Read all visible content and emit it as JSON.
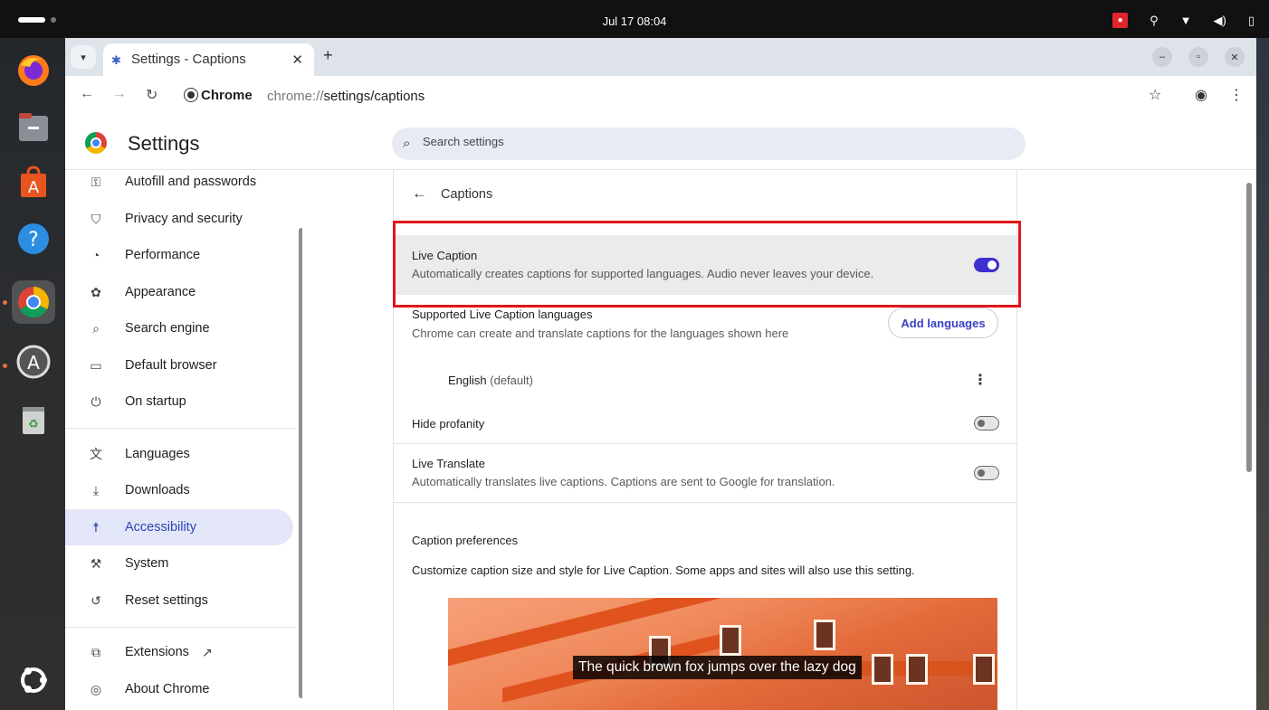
{
  "topbar": {
    "clock": "Jul 17  08:04"
  },
  "browser": {
    "tab_title": "Settings - Captions",
    "url_chip": "Chrome",
    "url_prefix": "chrome://",
    "url_path": "settings/captions"
  },
  "settings": {
    "title": "Settings",
    "search_placeholder": "Search settings"
  },
  "sidebar": {
    "items": [
      {
        "label": "Autofill and passwords",
        "icon": "key-icon"
      },
      {
        "label": "Privacy and security",
        "icon": "shield-icon"
      },
      {
        "label": "Performance",
        "icon": "speedometer-icon"
      },
      {
        "label": "Appearance",
        "icon": "palette-icon"
      },
      {
        "label": "Search engine",
        "icon": "search-icon"
      },
      {
        "label": "Default browser",
        "icon": "browser-window-icon"
      },
      {
        "label": "On startup",
        "icon": "power-icon"
      },
      {
        "label": "Languages",
        "icon": "translate-icon"
      },
      {
        "label": "Downloads",
        "icon": "download-icon"
      },
      {
        "label": "Accessibility",
        "icon": "accessibility-icon",
        "selected": true
      },
      {
        "label": "System",
        "icon": "wrench-icon"
      },
      {
        "label": "Reset settings",
        "icon": "reset-icon"
      },
      {
        "label": "Extensions",
        "icon": "puzzle-icon"
      },
      {
        "label": "About Chrome",
        "icon": "chrome-icon"
      }
    ]
  },
  "captions": {
    "header": "Captions",
    "live_caption_title": "Live Caption",
    "live_caption_desc": "Automatically creates captions for supported languages. Audio never leaves your device.",
    "live_caption_on": true,
    "supported_title": "Supported Live Caption languages",
    "supported_desc": "Chrome can create and translate captions for the languages shown here",
    "add_languages": "Add languages",
    "language_name": "English",
    "language_default": "(default)",
    "hide_profanity": "Hide profanity",
    "hide_profanity_on": false,
    "live_translate_title": "Live Translate",
    "live_translate_desc": "Automatically translates live captions. Captions are sent to Google for translation.",
    "live_translate_on": false,
    "prefs_title": "Caption preferences",
    "prefs_desc": "Customize caption size and style for Live Caption. Some apps and sites will also use this setting.",
    "preview_caption": "The quick brown fox jumps over the lazy dog"
  },
  "colors": {
    "accent": "#3d2fd0",
    "highlight_border": "#e0161b",
    "selected_nav_bg": "#e3e6f8"
  }
}
